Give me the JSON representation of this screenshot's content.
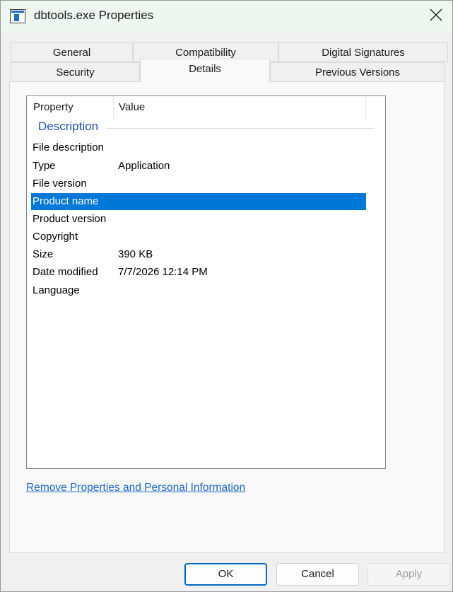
{
  "window": {
    "title": "dbtools.exe Properties"
  },
  "tabs": {
    "row_back": [
      "General",
      "Compatibility",
      "Digital Signatures"
    ],
    "row_front": [
      "Security",
      "Details",
      "Previous Versions"
    ],
    "active": "Details"
  },
  "details": {
    "columns": {
      "property": "Property",
      "value": "Value"
    },
    "group": "Description",
    "rows": [
      {
        "property": "File description",
        "value": ""
      },
      {
        "property": "Type",
        "value": "Application"
      },
      {
        "property": "File version",
        "value": ""
      },
      {
        "property": "Product name",
        "value": "",
        "selected": true
      },
      {
        "property": "Product version",
        "value": ""
      },
      {
        "property": "Copyright",
        "value": ""
      },
      {
        "property": "Size",
        "value": "390 KB"
      },
      {
        "property": "Date modified",
        "value": "7/7/2026 12:14 PM"
      },
      {
        "property": "Language",
        "value": ""
      }
    ],
    "remove_link": "Remove Properties and Personal Information"
  },
  "buttons": {
    "ok": "OK",
    "cancel": "Cancel",
    "apply": "Apply"
  },
  "colors": {
    "selection": "#0078d7",
    "link": "#1a66c9",
    "group_header": "#1e4fa8",
    "default_button_border": "#0067c0"
  },
  "icons": {
    "app": "app-window-icon",
    "close": "close-icon"
  }
}
